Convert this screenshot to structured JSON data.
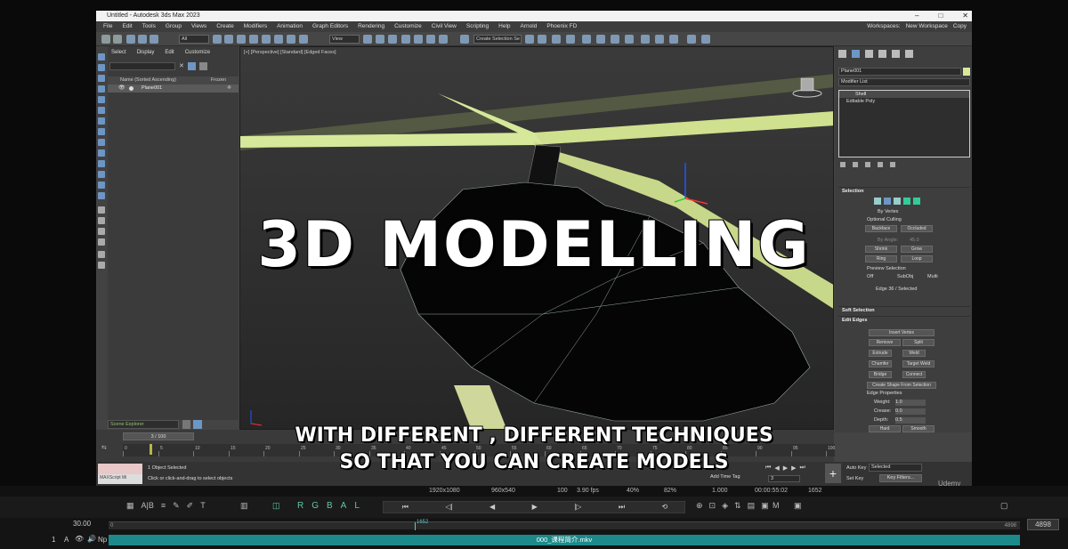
{
  "app": {
    "title": "Untitled - Autodesk 3ds Max 2023",
    "menu": [
      "File",
      "Edit",
      "Tools",
      "Group",
      "Views",
      "Create",
      "Modifiers",
      "Animation",
      "Graph Editors",
      "Rendering",
      "Customize",
      "Civil View",
      "Scripting",
      "Help",
      "Arnold",
      "Phoenix FD"
    ],
    "workspace_label": "Workspaces:",
    "workspace_value": "New Workspace",
    "copy_label": "Copy"
  },
  "toolbar": {
    "filter_value": "All",
    "view_value": "View",
    "selection_set": "Create Selection Se"
  },
  "explorer": {
    "tabs": [
      "Select",
      "Display",
      "Edit",
      "Customize"
    ],
    "column_name": "Name (Sorted Ascending)",
    "column_frozen": "Frozen",
    "object": "Plane001",
    "bottom_selector": "Scene Explorer"
  },
  "viewport": {
    "label": "[+] [Perspective] [Standard] [Edged Faces]"
  },
  "command_panel": {
    "object_name": "Plane001",
    "modifier_list": "Modifier List",
    "stack": [
      "Shell",
      "Editable Poly"
    ],
    "selection": {
      "title": "Selection",
      "by_vertex": "By Vertex",
      "ignore_culling": "Optional Culling",
      "backface": "Backface",
      "occluded": "Occluded",
      "by_angle": "By Angle:",
      "angle_value": "45.0",
      "shrink": "Shrink",
      "grow": "Grow",
      "ring": "Ring",
      "loop": "Loop",
      "preview": "Preview Selection",
      "off": "Off",
      "subobj": "SubObj",
      "multi": "Multi",
      "status": "Edge 36 / Selected"
    },
    "soft_selection": "Soft Selection",
    "edit_edges": {
      "title": "Edit Edges",
      "insert_vertex": "Insert Vertex",
      "remove": "Remove",
      "split": "Split",
      "extrude": "Extrude",
      "weld": "Weld",
      "chamfer": "Chamfer",
      "target_weld": "Target Weld",
      "bridge": "Bridge",
      "connect": "Connect",
      "create_shape": "Create Shape From Selection",
      "edge_props": "Edge Properties",
      "weight_label": "Weight:",
      "weight": "1.0",
      "crease_label": "Crease:",
      "crease": "0.0",
      "depth_label": "Depth:",
      "depth": "0.5",
      "hard": "Hard",
      "smooth": "Smooth"
    }
  },
  "timeline": {
    "frame": "3 / 100",
    "ticks": [
      "0",
      "5",
      "10",
      "15",
      "20",
      "25",
      "30",
      "35",
      "40",
      "45",
      "50",
      "55",
      "60",
      "65",
      "70",
      "75",
      "80",
      "85",
      "90",
      "95",
      "100"
    ]
  },
  "status": {
    "maxscript": "MAXScript Mi",
    "selected": "1 Object Selected",
    "hint": "Click or click-and-drag to select objects",
    "add_time_tag": "Add Time Tag",
    "autokey": "Auto Key",
    "setkey": "Set Key",
    "selected_dd": "Selected",
    "key_filters": "Key Filters...",
    "frame_field": "3"
  },
  "overlay": {
    "headline": "3D MODELLING",
    "subtitle_line1": "WITH DIFFERENT , DIFFERENT TECHNIQUES",
    "subtitle_line2": "SO THAT YOU CAN CREATE MODELS",
    "watermark": "Udemy"
  },
  "player": {
    "resolution": "1920x1080",
    "display_res": "960x540",
    "quality": "100",
    "fps": "3.90 fps",
    "zoom1": "40%",
    "zoom2": "82%",
    "speed": "1.000",
    "timecode": "00:00:55:02",
    "frame": "1652",
    "rgba": "RGBAL",
    "left_value": "30.00",
    "track_start": "0",
    "marker": "1652",
    "track_end": "4898",
    "right_value": "4898",
    "layer": "1",
    "layer_a": "A",
    "np": "Np",
    "clip_name": "000_课程简介.mkv"
  }
}
